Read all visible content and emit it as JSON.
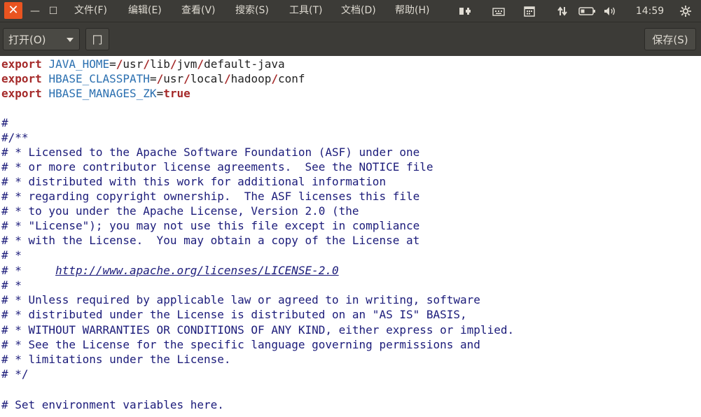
{
  "window": {
    "minimize_glyph": "—",
    "maximize_glyph": "☐"
  },
  "menu": [
    {
      "label": "文件(F)"
    },
    {
      "label": "编辑(E)"
    },
    {
      "label": "查看(V)"
    },
    {
      "label": "搜索(S)"
    },
    {
      "label": "工具(T)"
    },
    {
      "label": "文档(D)"
    },
    {
      "label": "帮助(H)"
    }
  ],
  "tray": {
    "time": "14:59",
    "icons": [
      "input-method-icon",
      "keyboard-icon",
      "calendar-icon",
      "network-icon",
      "battery-icon",
      "volume-icon",
      "settings-icon"
    ]
  },
  "toolbar": {
    "open_label": "打开(O)",
    "new_tab_glyph": "冂",
    "save_label": "保存(S)"
  },
  "editor": {
    "export1": {
      "kw": "export",
      "name": "JAVA_HOME",
      "eq": "=",
      "s1": "/",
      "p1": "usr",
      "s2": "/",
      "p2": "lib",
      "s3": "/",
      "p3": "jvm",
      "s4": "/",
      "p4": "default-java"
    },
    "export2": {
      "kw": "export",
      "name": "HBASE_CLASSPATH",
      "eq": "=",
      "s1": "/",
      "p1": "usr",
      "s2": "/",
      "p2": "local",
      "s3": "/",
      "p3": "hadoop",
      "s4": "/",
      "p4": "conf"
    },
    "export3": {
      "kw": "export",
      "name": "HBASE_MANAGES_ZK",
      "eq": "=",
      "value": "true"
    },
    "comments": [
      "#",
      "#/**",
      "# * Licensed to the Apache Software Foundation (ASF) under one",
      "# * or more contributor license agreements.  See the NOTICE file",
      "# * distributed with this work for additional information",
      "# * regarding copyright ownership.  The ASF licenses this file",
      "# * to you under the Apache License, Version 2.0 (the",
      "# * \"License\"); you may not use this file except in compliance",
      "# * with the License.  You may obtain a copy of the License at",
      "# *"
    ],
    "url_prefix": "# *     ",
    "url": "http://www.apache.org/licenses/LICENSE-2.0",
    "comments2": [
      "# *",
      "# * Unless required by applicable law or agreed to in writing, software",
      "# * distributed under the License is distributed on an \"AS IS\" BASIS,",
      "# * WITHOUT WARRANTIES OR CONDITIONS OF ANY KIND, either express or implied.",
      "# * See the License for the specific language governing permissions and",
      "# * limitations under the License.",
      "# */"
    ],
    "last": "# Set environment variables here."
  }
}
